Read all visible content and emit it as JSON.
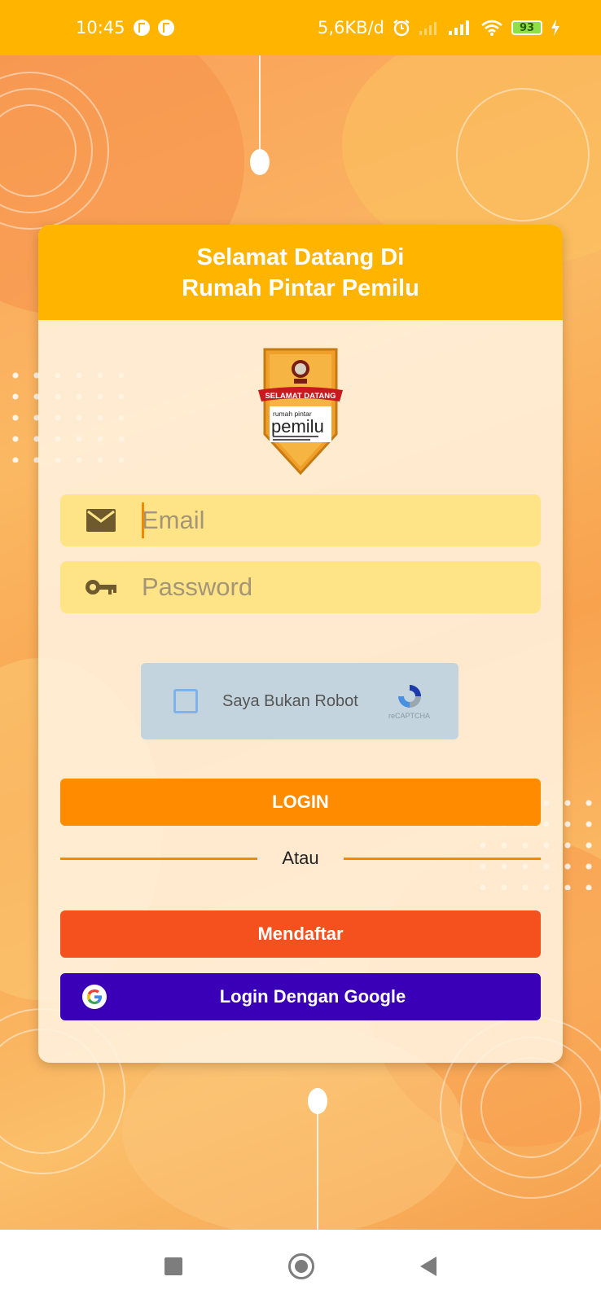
{
  "status_bar": {
    "time": "10:45",
    "network_speed": "5,6KB/d",
    "battery": "93"
  },
  "card": {
    "title_line1": "Selamat Datang Di",
    "title_line2": "Rumah Pintar Pemilu"
  },
  "logo": {
    "banner": "SELAMAT DATANG",
    "small": "rumah pintar",
    "big": "pemilu"
  },
  "form": {
    "email_placeholder": "Email",
    "email_value": "",
    "password_placeholder": "Password",
    "password_value": ""
  },
  "captcha": {
    "label": "Saya Bukan Robot",
    "brand": "reCAPTCHA"
  },
  "buttons": {
    "login": "LOGIN",
    "divider": "Atau",
    "register": "Mendaftar",
    "google": "Login Dengan Google"
  },
  "colors": {
    "status_bar": "#ffb400",
    "header": "#ffb400",
    "login": "#ff8c00",
    "register": "#f4511e",
    "google": "#3a00b8",
    "field": "#ffe487"
  },
  "icons": {
    "email": "mail-icon",
    "password": "key-icon",
    "google": "google-icon"
  }
}
